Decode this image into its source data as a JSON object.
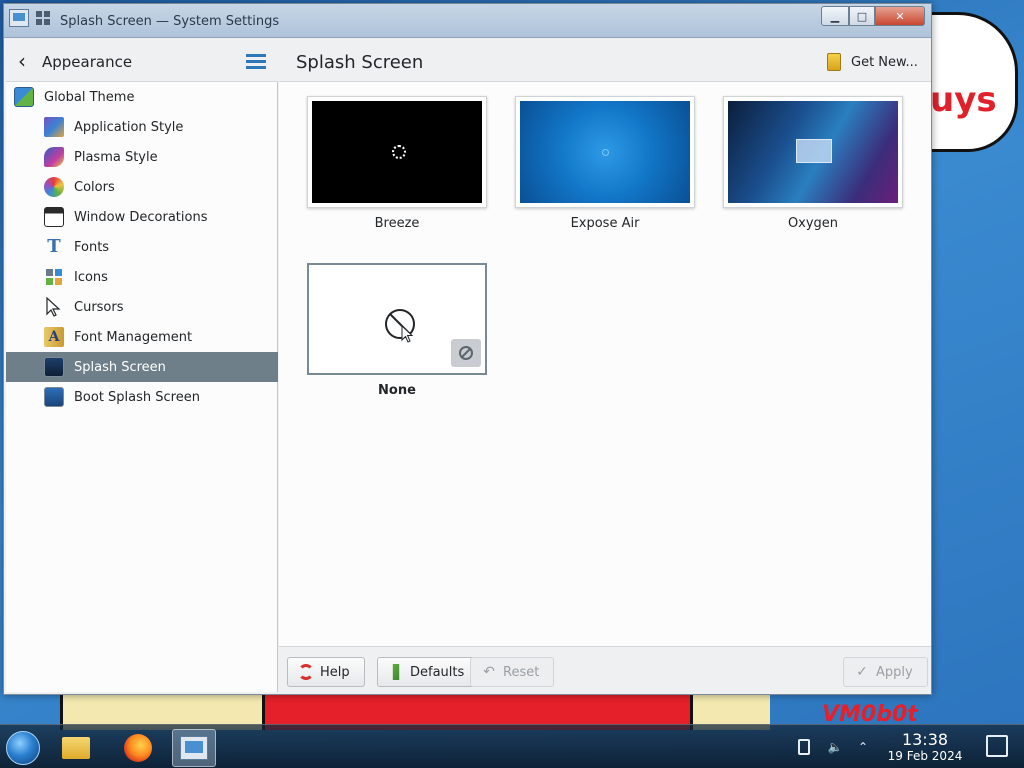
{
  "window": {
    "title": "Splash Screen — System Settings",
    "min_label": "▁",
    "max_label": "□",
    "close_label": "✕"
  },
  "sidebar": {
    "title": "Appearance",
    "items": [
      {
        "label": "Global Theme",
        "icon": "global-theme-icon"
      },
      {
        "label": "Application Style",
        "icon": "application-style-icon"
      },
      {
        "label": "Plasma Style",
        "icon": "plasma-style-icon"
      },
      {
        "label": "Colors",
        "icon": "colors-icon"
      },
      {
        "label": "Window Decorations",
        "icon": "window-decorations-icon"
      },
      {
        "label": "Fonts",
        "icon": "fonts-icon"
      },
      {
        "label": "Icons",
        "icon": "icons-icon"
      },
      {
        "label": "Cursors",
        "icon": "cursors-icon"
      },
      {
        "label": "Font Management",
        "icon": "font-management-icon"
      },
      {
        "label": "Splash Screen",
        "icon": "splash-screen-icon",
        "selected": true
      },
      {
        "label": "Boot Splash Screen",
        "icon": "boot-splash-screen-icon"
      }
    ]
  },
  "main": {
    "page_title": "Splash Screen",
    "get_new_label": "Get New...",
    "themes": [
      {
        "label": "Breeze"
      },
      {
        "label": "Expose Air"
      },
      {
        "label": "Oxygen"
      },
      {
        "label": "None",
        "selected": true
      }
    ]
  },
  "buttons": {
    "help": "Help",
    "defaults": "Defaults",
    "reset": "Reset",
    "apply": "Apply"
  },
  "desktop": {
    "cloud_text": "uys",
    "watermark": "VM0b0t"
  },
  "taskbar": {
    "time": "13:38",
    "date": "19 Feb 2024"
  },
  "colors": {
    "selection": "#6e7f8a",
    "accent": "#2e78b8",
    "close_button": "#c8462f"
  }
}
